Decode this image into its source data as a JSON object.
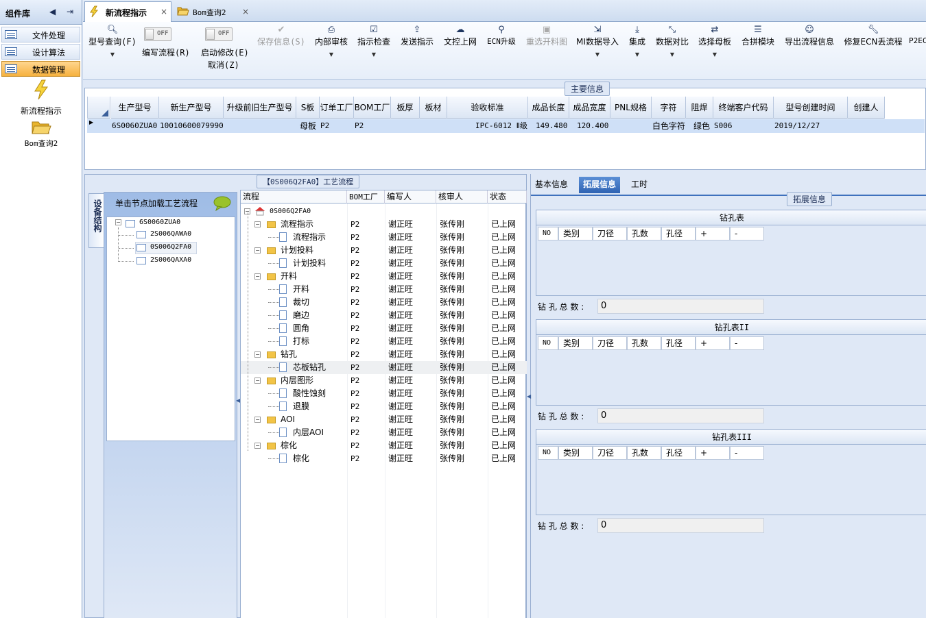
{
  "sidebar": {
    "title": "组件库",
    "items": [
      {
        "label": "文件处理"
      },
      {
        "label": "设计算法"
      },
      {
        "label": "数据管理"
      }
    ],
    "big_items": [
      {
        "label": "新流程指示"
      },
      {
        "label": "Bom查询2"
      }
    ]
  },
  "tabs": [
    {
      "label": "新流程指示",
      "close": "×"
    },
    {
      "label": "Bom查询2",
      "close": "×"
    }
  ],
  "toolbar": {
    "buttons": [
      {
        "label": "型号查询(F)"
      },
      {
        "label": "编写流程(R)",
        "toggle": "OFF"
      },
      {
        "label": "启动修改(E)",
        "label2": "取消(Z)",
        "toggle": "OFF"
      },
      {
        "label": "保存信息(S)"
      },
      {
        "label": "内部审核"
      },
      {
        "label": "指示检查"
      },
      {
        "label": "发送指示"
      },
      {
        "label": "文控上网"
      },
      {
        "label": "ECN升级"
      },
      {
        "label": "重选开料图"
      },
      {
        "label": "MI数据导入"
      },
      {
        "label": "集成"
      },
      {
        "label": "数据对比"
      },
      {
        "label": "选择母板"
      },
      {
        "label": "合拼模块"
      },
      {
        "label": "导出流程信息"
      },
      {
        "label": "修复ECN丢流程"
      },
      {
        "label": "P2EC"
      }
    ]
  },
  "main_info": {
    "title": "主要信息",
    "columns": [
      "生产型号",
      "新生产型号",
      "升级前旧生产型号",
      "S板",
      "订单工厂",
      "BOM工厂",
      "板厚",
      "板材",
      "验收标准",
      "成品长度",
      "成品宽度",
      "PNL规格",
      "字符",
      "阻焊",
      "终端客户代码",
      "型号创建时间",
      "创建人"
    ],
    "row": [
      "6S0060ZUA0",
      "10010600079990",
      "",
      "母板",
      "P2",
      "P2",
      "",
      "",
      "IPC-6012 Ⅱ级",
      "149.480",
      "120.400",
      "",
      "白色字符",
      "绿色",
      "S006",
      "2019/12/27",
      ""
    ]
  },
  "left_panel": {
    "vtab": "设备结构",
    "tree_title": "单击节点加载工艺流程",
    "tree": [
      "6S0060ZUA0",
      "2S006QAWA0",
      "0S006Q2FA0",
      "2S006QAXA0"
    ]
  },
  "process": {
    "title": "【0S006Q2FA0】工艺流程",
    "columns": [
      "流程",
      "BOM工厂",
      "编写人",
      "核审人",
      "状态"
    ],
    "root": "0S006Q2FA0",
    "rows": [
      {
        "name": "流程指示",
        "folder": true
      },
      {
        "name": "流程指示",
        "folder": false
      },
      {
        "name": "计划投料",
        "folder": true
      },
      {
        "name": "计划投料",
        "folder": false
      },
      {
        "name": "开料",
        "folder": true
      },
      {
        "name": "开料",
        "folder": false
      },
      {
        "name": "裁切",
        "folder": false
      },
      {
        "name": "磨边",
        "folder": false
      },
      {
        "name": "圆角",
        "folder": false
      },
      {
        "name": "打标",
        "folder": false
      },
      {
        "name": "钻孔",
        "folder": true
      },
      {
        "name": "芯板钻孔",
        "folder": false
      },
      {
        "name": "内层图形",
        "folder": true
      },
      {
        "name": "酸性蚀刻",
        "folder": false
      },
      {
        "name": "退膜",
        "folder": false
      },
      {
        "name": "AOI",
        "folder": true
      },
      {
        "name": "内层AOI",
        "folder": false
      },
      {
        "name": "棕化",
        "folder": true
      },
      {
        "name": "棕化",
        "folder": false
      }
    ],
    "bom": "P2",
    "writer": "谢正旺",
    "checker": "张传刚",
    "status": "已上网"
  },
  "right_panel": {
    "tabs": [
      "基本信息",
      "拓展信息",
      "工时"
    ],
    "group_title": "拓展信息",
    "drill_tables": [
      {
        "title": "钻孔表"
      },
      {
        "title": "钻孔表II"
      },
      {
        "title": "钻孔表III"
      }
    ],
    "drill_columns": [
      "NO",
      "类别",
      "刀径",
      "孔数",
      "孔径",
      "+",
      "-"
    ],
    "total_label": "钻 孔 总 数 :",
    "total_value": "0"
  }
}
